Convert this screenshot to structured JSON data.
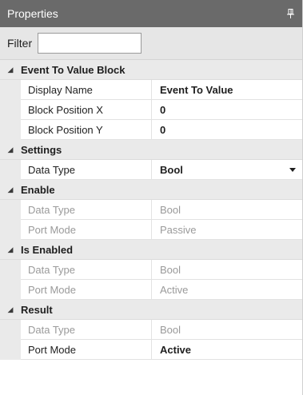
{
  "panel": {
    "title": "Properties",
    "pin_icon": "pin-icon"
  },
  "filter": {
    "label": "Filter",
    "value": "",
    "placeholder": ""
  },
  "categories": [
    {
      "name": "Event To Value Block",
      "rows": [
        {
          "label": "Display Name",
          "value": "Event To Value"
        },
        {
          "label": "Block Position X",
          "value": "0"
        },
        {
          "label": "Block Position Y",
          "value": "0"
        }
      ]
    },
    {
      "name": "Settings",
      "rows": [
        {
          "label": "Data Type",
          "value": "Bool"
        }
      ]
    },
    {
      "name": "Enable",
      "rows": [
        {
          "label": "Data Type",
          "value": "Bool"
        },
        {
          "label": "Port Mode",
          "value": "Passive"
        }
      ]
    },
    {
      "name": "Is Enabled",
      "rows": [
        {
          "label": "Data Type",
          "value": "Bool"
        },
        {
          "label": "Port Mode",
          "value": "Active"
        }
      ]
    },
    {
      "name": "Result",
      "rows": [
        {
          "label": "Data Type",
          "value": "Bool"
        },
        {
          "label": "Port Mode",
          "value": "Active"
        }
      ]
    }
  ],
  "colors": {
    "titlebar": "#6a6a6a",
    "category_bg": "#eaeaea",
    "disabled_text": "#9a9a9a"
  }
}
